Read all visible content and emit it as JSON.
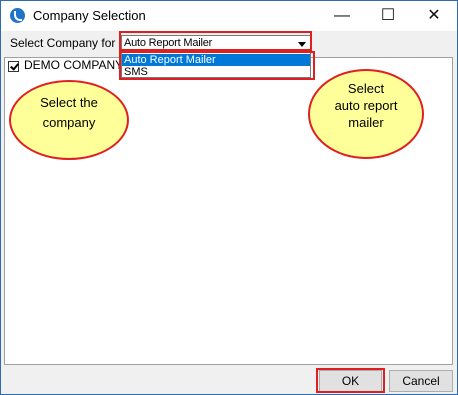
{
  "window": {
    "title": "Company Selection",
    "minimize": "—",
    "maximize": "☐",
    "close": "✕"
  },
  "filter": {
    "label": "Select Company for",
    "selected": "Auto Report Mailer",
    "options": [
      "Auto Report Mailer",
      "SMS"
    ]
  },
  "companies": [
    {
      "name": "DEMO COMPANY",
      "checked": true
    }
  ],
  "callouts": {
    "company": [
      "Select  the",
      "company"
    ],
    "mailer": [
      "Select",
      "auto  report",
      "mailer"
    ]
  },
  "buttons": {
    "ok": "OK",
    "cancel": "Cancel"
  },
  "colors": {
    "highlight": "#e02020",
    "callout_fill": "#ffff99",
    "selection": "#0078d7"
  }
}
